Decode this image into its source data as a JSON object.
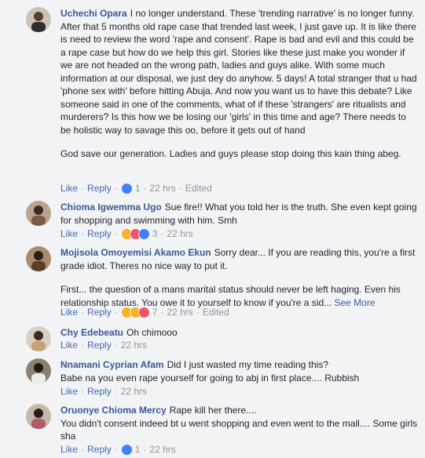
{
  "comments": [
    {
      "author": "Uchechi Opara",
      "text": "I no longer understand. These 'trending narrative' is no longer funny. After that 5 months old rape case that trended last week, I just gave up. It is like there is need to review the word 'rape and consent'. Rape is bad and evil and this could be a rape case but how do we help this girl. Stories like these just make you wonder if we are not headed on the wrong path, ladies and guys alike. With some much information at our disposal, we just dey do anyhow. 5 days! A total stranger that u had 'phone sex with' before hitting Abuja. And now you want us to have this debate? Like someone said in one of the comments, what of if these 'strangers' are ritualists and murderers? Is this how we be losing our 'girls' in this time and age? There needs to be holistic way to savage this oo, before it gets out of hand",
      "text2": "God save our generation. Ladies and guys please stop doing this kain thing abeg.",
      "like": "Like",
      "reply": "Reply",
      "reactions_count": "1",
      "time": "22 hrs",
      "edited": "Edited"
    },
    {
      "author": "Chioma Igwemma Ugo",
      "text": "Sue fire!! What you told her is the truth. She even kept going for shopping and swimming with him. Smh",
      "like": "Like",
      "reply": "Reply",
      "reactions_count": "3",
      "time": "22 hrs"
    },
    {
      "author": "Mojisola Omoyemisi Akamo Ekun",
      "text": "Sorry dear... If you are reading this, you're a first grade idiot. Theres no nice way to put it.",
      "text2": "First... the question of a mans marital status should never be left haging. Even his relationship status. You owe it to yourself to know if you're a sid...",
      "see_more": "See More",
      "like": "Like",
      "reply": "Reply",
      "reactions_count": "7",
      "time": "22 hrs",
      "edited": "Edited"
    },
    {
      "author": "Chy Edebeatu",
      "text": "Oh chimooo",
      "like": "Like",
      "reply": "Reply",
      "time": "22 hrs"
    },
    {
      "author": "Nnamani Cyprian Afam",
      "text": "Did I just wasted my time reading this?",
      "text2": "Babe na you even rape yourself for going to abj in first place.... Rubbish",
      "like": "Like",
      "reply": "Reply",
      "time": "22 hrs"
    },
    {
      "author": "Oruonye Chioma Mercy",
      "text": "Rape kill her there....",
      "text2": "You didn't consent indeed bt u went shopping and even went to the mall.... Some girls sha",
      "like": "Like",
      "reply": "Reply",
      "reactions_count": "1",
      "time": "22 hrs"
    }
  ],
  "colors": {
    "name": "#385898",
    "link": "#4267b2",
    "meta": "#90949c",
    "like_reaction": "#4080ff",
    "love_reaction": "#f25268",
    "haha_reaction": "#f7b125",
    "background": "#f2f3f5"
  }
}
